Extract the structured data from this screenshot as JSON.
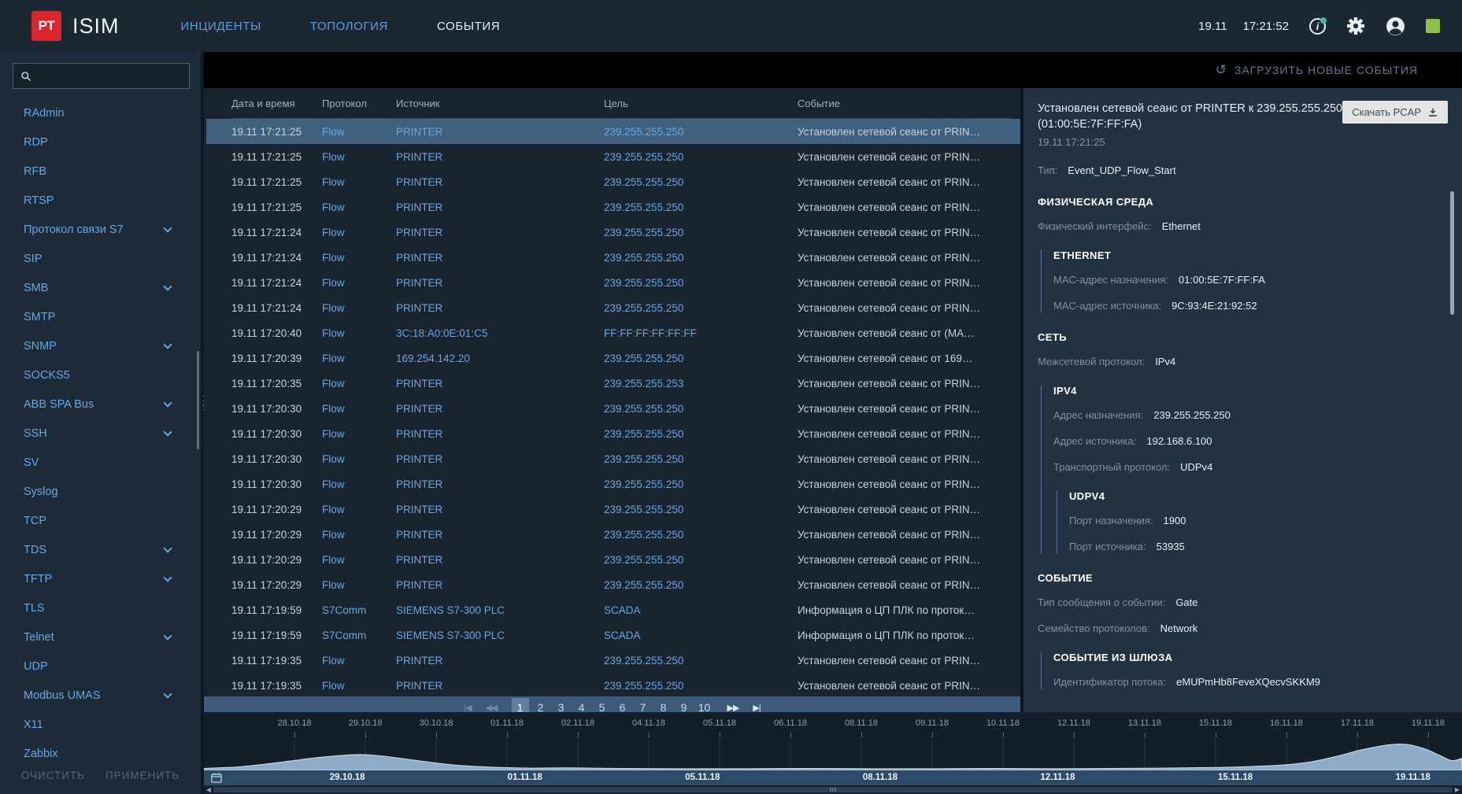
{
  "topbar": {
    "logo_text": "PT",
    "product_name": "ISIM",
    "tabs": [
      {
        "label": "ИНЦИДЕНТЫ",
        "active": false
      },
      {
        "label": "ТОПОЛОГИЯ",
        "active": false
      },
      {
        "label": "СОБЫТИЯ",
        "active": true
      }
    ],
    "date": "19.11",
    "time": "17:21:52",
    "icons": [
      "info-icon",
      "settings-icon",
      "user-icon",
      "status-indicator"
    ],
    "status_color": "#8bc34a",
    "info_glyph": "i"
  },
  "black_bar": {
    "refresh_icon": "↺",
    "load_new_events": "ЗАГРУЗИТЬ НОВЫЕ СОБЫТИЯ"
  },
  "sidebar": {
    "search_placeholder": "",
    "items": [
      {
        "label": "RAdmin",
        "expandable": false
      },
      {
        "label": "RDP",
        "expandable": false
      },
      {
        "label": "RFB",
        "expandable": false
      },
      {
        "label": "RTSP",
        "expandable": false
      },
      {
        "label": "Протокол связи S7",
        "expandable": true
      },
      {
        "label": "SIP",
        "expandable": false
      },
      {
        "label": "SMB",
        "expandable": true
      },
      {
        "label": "SMTP",
        "expandable": false
      },
      {
        "label": "SNMP",
        "expandable": true
      },
      {
        "label": "SOCKS5",
        "expandable": false
      },
      {
        "label": "ABB SPA Bus",
        "expandable": true
      },
      {
        "label": "SSH",
        "expandable": true
      },
      {
        "label": "SV",
        "expandable": false
      },
      {
        "label": "Syslog",
        "expandable": false
      },
      {
        "label": "TCP",
        "expandable": false
      },
      {
        "label": "TDS",
        "expandable": true
      },
      {
        "label": "TFTP",
        "expandable": true
      },
      {
        "label": "TLS",
        "expandable": false
      },
      {
        "label": "Telnet",
        "expandable": true
      },
      {
        "label": "UDP",
        "expandable": false
      },
      {
        "label": "Modbus UMAS",
        "expandable": true
      },
      {
        "label": "X11",
        "expandable": false
      },
      {
        "label": "Zabbix",
        "expandable": false
      }
    ],
    "clear_button": "ОЧИСТИТЬ",
    "apply_button": "ПРИМЕНИТЬ"
  },
  "events_table": {
    "columns": [
      "Дата и время",
      "Протокол",
      "Источник",
      "Цель",
      "Событие"
    ],
    "rows": [
      {
        "date": "19.11 17:21:25",
        "protocol": "Flow",
        "source": "PRINTER",
        "target": "239.255.255.250",
        "event": "Установлен сетевой сеанс от PRIN…",
        "selected": true
      },
      {
        "date": "19.11 17:21:25",
        "protocol": "Flow",
        "source": "PRINTER",
        "target": "239.255.255.250",
        "event": "Установлен сетевой сеанс от PRIN…",
        "selected": false
      },
      {
        "date": "19.11 17:21:25",
        "protocol": "Flow",
        "source": "PRINTER",
        "target": "239.255.255.250",
        "event": "Установлен сетевой сеанс от PRIN…",
        "selected": false
      },
      {
        "date": "19.11 17:21:25",
        "protocol": "Flow",
        "source": "PRINTER",
        "target": "239.255.255.250",
        "event": "Установлен сетевой сеанс от PRIN…",
        "selected": false
      },
      {
        "date": "19.11 17:21:24",
        "protocol": "Flow",
        "source": "PRINTER",
        "target": "239.255.255.250",
        "event": "Установлен сетевой сеанс от PRIN…",
        "selected": false
      },
      {
        "date": "19.11 17:21:24",
        "protocol": "Flow",
        "source": "PRINTER",
        "target": "239.255.255.250",
        "event": "Установлен сетевой сеанс от PRIN…",
        "selected": false
      },
      {
        "date": "19.11 17:21:24",
        "protocol": "Flow",
        "source": "PRINTER",
        "target": "239.255.255.250",
        "event": "Установлен сетевой сеанс от PRIN…",
        "selected": false
      },
      {
        "date": "19.11 17:21:24",
        "protocol": "Flow",
        "source": "PRINTER",
        "target": "239.255.255.250",
        "event": "Установлен сетевой сеанс от PRIN…",
        "selected": false
      },
      {
        "date": "19.11 17:20:40",
        "protocol": "Flow",
        "source": "3C:18:A0:0E:01:C5",
        "target": "FF:FF:FF:FF:FF:FF",
        "event": "Установлен сетевой сеанс от (MA…",
        "selected": false
      },
      {
        "date": "19.11 17:20:39",
        "protocol": "Flow",
        "source": "169.254.142.20",
        "target": "239.255.255.250",
        "event": "Установлен сетевой сеанс от 169…",
        "selected": false
      },
      {
        "date": "19.11 17:20:35",
        "protocol": "Flow",
        "source": "PRINTER",
        "target": "239.255.255.253",
        "event": "Установлен сетевой сеанс от PRIN…",
        "selected": false
      },
      {
        "date": "19.11 17:20:30",
        "protocol": "Flow",
        "source": "PRINTER",
        "target": "239.255.255.250",
        "event": "Установлен сетевой сеанс от PRIN…",
        "selected": false
      },
      {
        "date": "19.11 17:20:30",
        "protocol": "Flow",
        "source": "PRINTER",
        "target": "239.255.255.250",
        "event": "Установлен сетевой сеанс от PRIN…",
        "selected": false
      },
      {
        "date": "19.11 17:20:30",
        "protocol": "Flow",
        "source": "PRINTER",
        "target": "239.255.255.250",
        "event": "Установлен сетевой сеанс от PRIN…",
        "selected": false
      },
      {
        "date": "19.11 17:20:30",
        "protocol": "Flow",
        "source": "PRINTER",
        "target": "239.255.255.250",
        "event": "Установлен сетевой сеанс от PRIN…",
        "selected": false
      },
      {
        "date": "19.11 17:20:29",
        "protocol": "Flow",
        "source": "PRINTER",
        "target": "239.255.255.250",
        "event": "Установлен сетевой сеанс от PRIN…",
        "selected": false
      },
      {
        "date": "19.11 17:20:29",
        "protocol": "Flow",
        "source": "PRINTER",
        "target": "239.255.255.250",
        "event": "Установлен сетевой сеанс от PRIN…",
        "selected": false
      },
      {
        "date": "19.11 17:20:29",
        "protocol": "Flow",
        "source": "PRINTER",
        "target": "239.255.255.250",
        "event": "Установлен сетевой сеанс от PRIN…",
        "selected": false
      },
      {
        "date": "19.11 17:20:29",
        "protocol": "Flow",
        "source": "PRINTER",
        "target": "239.255.255.250",
        "event": "Установлен сетевой сеанс от PRIN…",
        "selected": false
      },
      {
        "date": "19.11 17:19:59",
        "protocol": "S7Comm",
        "source": "SIEMENS S7-300 PLC",
        "target": "SCADA",
        "event": "Информация о ЦП ПЛК по проток…",
        "selected": false
      },
      {
        "date": "19.11 17:19:59",
        "protocol": "S7Comm",
        "source": "SIEMENS S7-300 PLC",
        "target": "SCADA",
        "event": "Информация о ЦП ПЛК по проток…",
        "selected": false
      },
      {
        "date": "19.11 17:19:35",
        "protocol": "Flow",
        "source": "PRINTER",
        "target": "239.255.255.250",
        "event": "Установлен сетевой сеанс от PRIN…",
        "selected": false
      },
      {
        "date": "19.11 17:19:35",
        "protocol": "Flow",
        "source": "PRINTER",
        "target": "239.255.255.250",
        "event": "Установлен сетевой сеанс от PRIN…",
        "selected": false
      }
    ],
    "pagination": {
      "first_icon": "|◀",
      "prev_icon": "◀◀",
      "pages": [
        "1",
        "2",
        "3",
        "4",
        "5",
        "6",
        "7",
        "8",
        "9",
        "10"
      ],
      "active_page": "1",
      "next_icon": "▶▶",
      "last_icon": "▶|"
    }
  },
  "details": {
    "title": "Установлен сетевой сеанс от PRINTER к 239.255.255.250 (01:00:5E:7F:FF:FA)",
    "timestamp": "19.11 17:21:25",
    "pcap_button": "Скачать PCAP",
    "type_label": "Тип:",
    "type_value": "Event_UDP_Flow_Start",
    "phys": {
      "header": "ФИЗИЧЕСКАЯ СРЕДА",
      "iface_label": "Физический интерфейс:",
      "iface_value": "Ethernet",
      "ethernet": {
        "header": "ETHERNET",
        "mac_dst_label": "MAC-адрес назначения:",
        "mac_dst": "01:00:5E:7F:FF:FA",
        "mac_src_label": "MAC-адрес источника:",
        "mac_src": "9C:93:4E:21:92:52"
      }
    },
    "net": {
      "header": "СЕТЬ",
      "ip_label": "Межсетевой протокол:",
      "ip_value": "IPv4",
      "ipv4": {
        "header": "IPV4",
        "dst_label": "Адрес назначения:",
        "dst": "239.255.255.250",
        "src_label": "Адрес источника:",
        "src": "192.168.6.100",
        "transport_label": "Транспортный протокол:",
        "transport": "UDPv4",
        "udpv4": {
          "header": "UDPV4",
          "dst_port_label": "Порт назначения:",
          "dst_port": "1900",
          "src_port_label": "Порт источника:",
          "src_port": "53935"
        }
      }
    },
    "event": {
      "header": "СОБЫТИЕ",
      "msg_type_label": "Тип сообщения о событии:",
      "msg_type": "Gate",
      "family_label": "Семейство протоколов:",
      "family": "Network",
      "gateway": {
        "header": "СОБЫТИЕ ИЗ ШЛЮЗА",
        "flow_id_label": "Идентификатор потока:",
        "flow_id": "eMUPmHb8FeveXQecvSKKM9"
      }
    }
  },
  "timeline": {
    "ticks": [
      "28.10.18",
      "29.10.18",
      "30.10.18",
      "01.11.18",
      "02.11.18",
      "04.11.18",
      "05.11.18",
      "06.11.18",
      "08.11.18",
      "09.11.18",
      "10.11.18",
      "12.11.18",
      "13.11.18",
      "15.11.18",
      "16.11.18",
      "17.11.18",
      "19.11.18"
    ],
    "range_labels": [
      "29.10.18",
      "01.11.18",
      "05.11.18",
      "08.11.18",
      "12.11.18",
      "15.11.18",
      "19.11.18"
    ]
  },
  "chart_data": {
    "type": "area",
    "title": "",
    "xlabel": "",
    "ylabel": "",
    "x_ticks": [
      "28.10.18",
      "29.10.18",
      "30.10.18",
      "01.11.18",
      "02.11.18",
      "04.11.18",
      "05.11.18",
      "06.11.18",
      "08.11.18",
      "09.11.18",
      "10.11.18",
      "12.11.18",
      "13.11.18",
      "15.11.18",
      "16.11.18",
      "17.11.18",
      "19.11.18"
    ],
    "values_at_ticks": [
      28,
      50,
      27,
      9,
      4,
      3,
      3,
      3,
      4,
      3,
      3,
      4,
      3,
      5,
      14,
      58,
      40
    ],
    "ylim": [
      0,
      100
    ],
    "grid": true,
    "legend": false,
    "fill_color": "#9fc0de",
    "line_color": "#cfe1f0",
    "curve_points": [
      [
        0,
        4
      ],
      [
        3,
        10
      ],
      [
        6,
        24
      ],
      [
        9,
        40
      ],
      [
        12,
        50
      ],
      [
        14,
        46
      ],
      [
        17,
        30
      ],
      [
        20,
        15
      ],
      [
        23,
        8
      ],
      [
        26,
        5
      ],
      [
        29,
        6
      ],
      [
        33,
        4
      ],
      [
        38,
        3
      ],
      [
        43,
        3
      ],
      [
        48,
        4
      ],
      [
        53,
        3
      ],
      [
        58,
        3
      ],
      [
        63,
        4
      ],
      [
        68,
        3
      ],
      [
        72,
        4
      ],
      [
        76,
        5
      ],
      [
        80,
        7
      ],
      [
        83,
        10
      ],
      [
        86,
        16
      ],
      [
        88,
        26
      ],
      [
        90,
        44
      ],
      [
        92,
        66
      ],
      [
        94,
        82
      ],
      [
        95.5,
        85
      ],
      [
        97,
        70
      ],
      [
        98.3,
        46
      ],
      [
        99.2,
        30
      ],
      [
        100,
        38
      ]
    ]
  }
}
